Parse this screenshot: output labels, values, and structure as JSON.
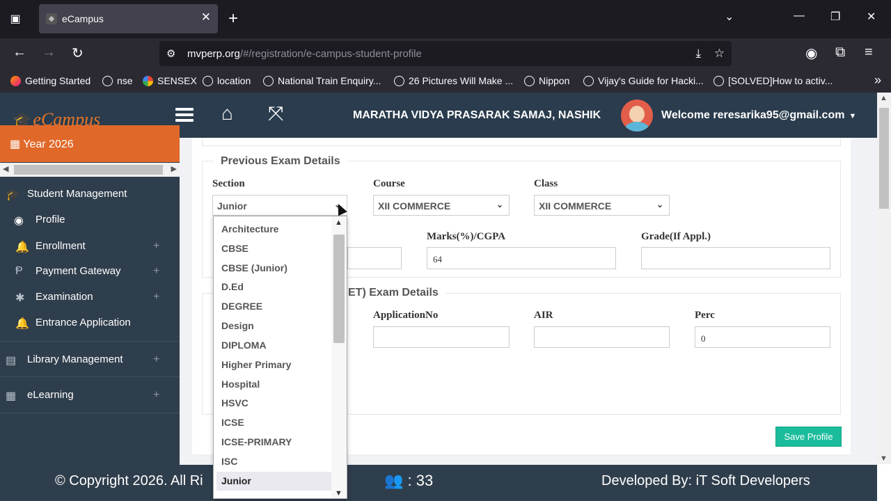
{
  "browser": {
    "tab_title": "eCampus",
    "url_host": "mvperp.org",
    "url_path": "/#/registration/e-campus-student-profile",
    "bookmarks": [
      "Getting Started",
      "nse",
      "SENSEX",
      "location",
      "National Train Enquiry...",
      "26 Pictures Will Make ...",
      "Nippon",
      "Vijay's Guide for Hacki...",
      "[SOLVED]How to activ..."
    ]
  },
  "header": {
    "logo_text": "eCampus",
    "org_name": "MARATHA VIDYA PRASARAK SAMAJ, NASHIK",
    "welcome": "Welcome reresarika95@gmail.com"
  },
  "sidebar": {
    "year": "Year 2026",
    "items": [
      {
        "label": "Student Management"
      },
      {
        "label": "Profile"
      },
      {
        "label": "Enrollment"
      },
      {
        "label": "Payment Gateway"
      },
      {
        "label": "Examination"
      },
      {
        "label": "Entrance Application"
      },
      {
        "label": "Library Management"
      },
      {
        "label": "eLearning"
      }
    ]
  },
  "previous_exam": {
    "legend": "Previous Exam Details",
    "section_label": "Section",
    "section_value": "Junior",
    "course_label": "Course",
    "course_value": "XII COMMERCE",
    "class_label": "Class",
    "class_value": "XII COMMERCE",
    "marks_label": "Marks(%)/CGPA",
    "marks_value": "64",
    "grade_label": "Grade(If Appl.)",
    "grade_value": ""
  },
  "entrance_exam": {
    "legend_visible": "ET) Exam Details",
    "appno_label": "ApplicationNo",
    "appno_value": "",
    "air_label": "AIR",
    "air_value": "",
    "perc_label": "Perc",
    "perc_value": "0"
  },
  "save_button": "Save Profile",
  "dropdown_options": [
    "Architecture",
    "CBSE",
    "CBSE (Junior)",
    "D.Ed",
    "DEGREE",
    "Design",
    "DIPLOMA",
    "Higher Primary",
    "Hospital",
    "HSVC",
    "ICSE",
    "ICSE-PRIMARY",
    "ISC",
    "Junior"
  ],
  "dropdown_selected": "Junior",
  "footer": {
    "copyright": "© Copyright 2026. All Ri",
    "visitors": ": 33",
    "developed_by": "Developed By: iT Soft Developers"
  },
  "colors": {
    "accent_orange": "#e0692a",
    "sidebar_bg": "#2f3e4c",
    "save_green": "#1abc9c"
  }
}
